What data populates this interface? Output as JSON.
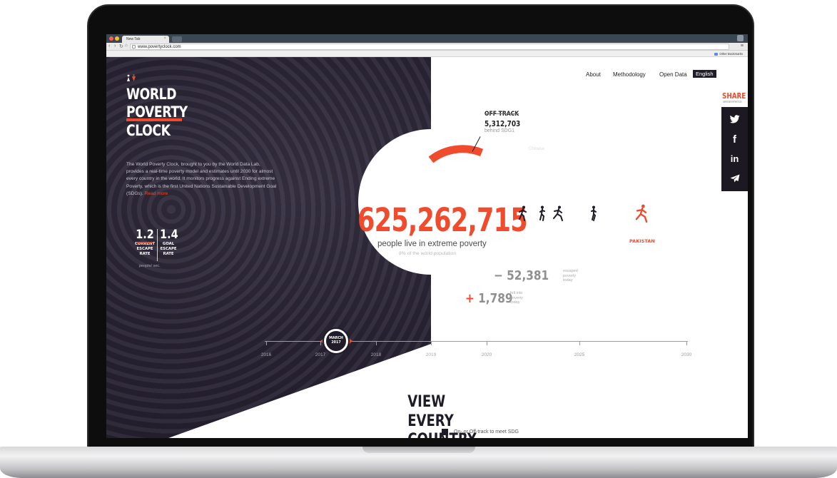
{
  "browser": {
    "tab_title": "New Tab",
    "url": "www.povertyclock.com",
    "bookmarks": [
      "ATP-Design",
      "Minimalist",
      "Inbek",
      "Design tools",
      "3D Printing",
      "« Wax alpha 2-0",
      "Track",
      "Netflix",
      "AirDroid",
      "Roberts Space Indu…",
      "Igo - your global ro…",
      "Dissego - Dashboard",
      "PDF",
      "Platformplatser",
      "studium",
      "RBI subscriber servic…",
      "BLENDER Tutorials",
      "Warhorse studios ro…",
      "Latest Topics - Kilo…",
      "Hype Thrd Bank - Lo…",
      "ICONS"
    ],
    "other_bookmarks": "Other Bookmarks"
  },
  "nav": {
    "about": "About",
    "methodology": "Methodology",
    "open_data": "Open Data",
    "language": "English"
  },
  "hero": {
    "title_1": "WORLD",
    "title_2": "POVERTY",
    "title_3": "CLOCK",
    "intro": "The World Poverty Clock, brought to you by the World Data Lab, provides a real-time poverty model and estimates until 2030 for almost every country in the world. It monitors progress against Ending extreme Poverty, which is the first United Nations Sustainable Development Goal (SDGs).",
    "read_more": "Read more"
  },
  "rates": {
    "current_value": "1.2",
    "current_label_1": "CURRENT",
    "current_label_2": "ESCAPE",
    "current_label_3": "RATE",
    "goal_value": "1.4",
    "goal_label_1": "GOAL",
    "goal_label_2": "ESCAPE",
    "goal_label_3": "RATE",
    "unit": "people/ sec."
  },
  "share": {
    "title": "SHARE",
    "subtitle": "awareness",
    "icons": [
      "twitter-icon",
      "facebook-icon",
      "linkedin-icon",
      "send-icon"
    ]
  },
  "off_track": {
    "label": "OFF TRACK",
    "number": "5,312,703",
    "sub": "behind SDG1",
    "hint": "Chinese"
  },
  "count": {
    "value": "625,262,715",
    "people_line": "people live in extreme poverty",
    "pct_line": "8% of the world population",
    "country": "PAKISTAN"
  },
  "flows": {
    "escaped_value": "− 52,381",
    "escaped_label_1": "escaped",
    "escaped_label_2": "poverty",
    "escaped_label_3": "today",
    "fell_sign": "+",
    "fell_value": " 1,789",
    "fell_label_1": "fell into",
    "fell_label_2": "poverty",
    "fell_label_3": "today"
  },
  "timeline": {
    "years": [
      "2016",
      "2017",
      "2018",
      "2019",
      "2020",
      "2025",
      "2030"
    ],
    "marker_month": "MARCH",
    "marker_year": "2017"
  },
  "view_every_country": {
    "line_1": "VIEW",
    "line_2": "EVERY",
    "line_3": "COUNTRY",
    "note": "On- or Off-track to meet SDG"
  },
  "colors": {
    "accent": "#f04b2c",
    "dark": "#1f1b28"
  }
}
